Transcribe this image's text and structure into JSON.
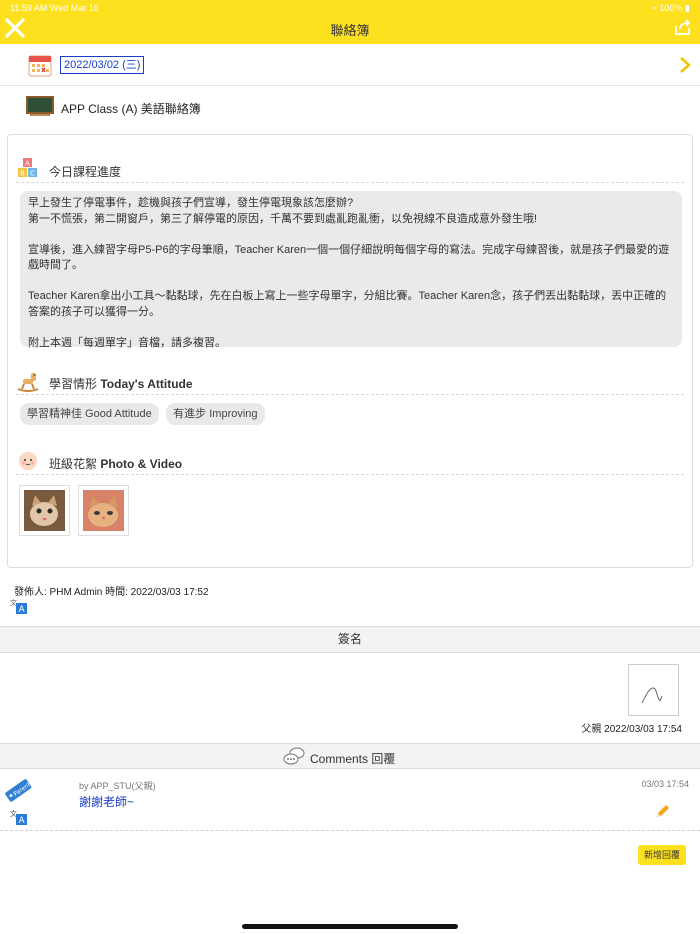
{
  "status_bar": {
    "time": "11:59 AM  Wed Mar 16",
    "battery": "100%"
  },
  "nav": {
    "title": "聯絡簿"
  },
  "date_row": {
    "date": "2022/03/02 (三)"
  },
  "class_row": {
    "class_name": "APP Class (A) 美語聯絡簿"
  },
  "progress": {
    "title": "今日課程進度",
    "paragraphs": [
      "早上發生了停電事件，趁機與孩子們宣導，發生停電現象該怎麼辦?\n第一不慌張，第二開窗戶，第三了解停電的原因，千萬不要到處亂跑亂衝，以免視線不良造成意外發生哦!",
      "宣導後，進入練習字母P5-P6的字母筆順，Teacher Karen一個一個仔細說明每個字母的寫法。完成字母練習後，就是孩子們最愛的遊戲時間了。",
      "Teacher Karen拿出小工具～黏黏球，先在白板上寫上一些字母單字，分組比賽。Teacher Karen念，孩子們丟出黏黏球，丟中正確的答案的孩子可以獲得一分。",
      "附上本週「每週單字」音檔，請多複習。"
    ]
  },
  "attitude": {
    "title_cn": "學習情形",
    "title_en": "Today's Attitude",
    "chips": [
      "學習精神佳 Good Attitude",
      "有進步 Improving"
    ]
  },
  "photos": {
    "title_cn": "班級花絮",
    "title_en": "Photo & Video"
  },
  "poster": {
    "text": "發佈人: PHM Admin 時間: 2022/03/03 17:52"
  },
  "signature": {
    "bar_title": "簽名",
    "caption": "父親 2022/03/03 17:54"
  },
  "comments": {
    "bar_title": "Comments 回覆",
    "items": [
      {
        "by": "by APP_STU(父親)",
        "text": "謝謝老師~",
        "time": "03/03 17:54",
        "badge": "Parent"
      }
    ],
    "add_label": "新增回覆"
  },
  "colors": {
    "accent": "#fde11e",
    "link": "#1a3ec8"
  }
}
